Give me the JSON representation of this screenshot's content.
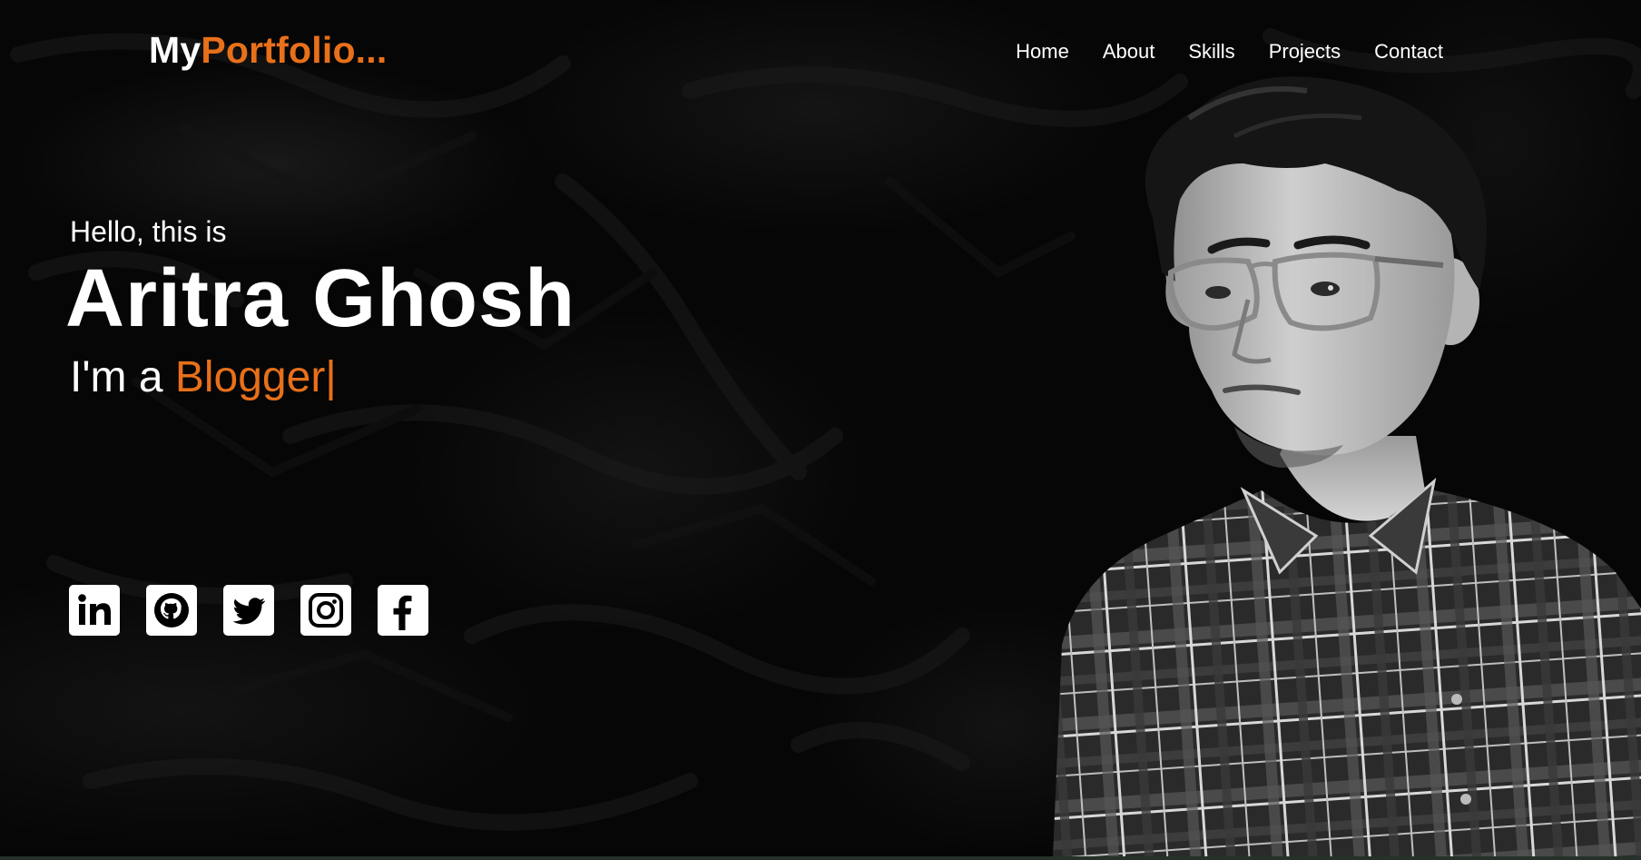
{
  "logo": {
    "prefix": "My",
    "accent": "Portfolio..."
  },
  "nav": {
    "items": [
      {
        "label": "Home"
      },
      {
        "label": "About"
      },
      {
        "label": "Skills"
      },
      {
        "label": "Projects"
      },
      {
        "label": "Contact"
      }
    ]
  },
  "hero": {
    "greeting": "Hello, this is",
    "name": "Aritra Ghosh",
    "role_prefix": "I'm a ",
    "role_typed": "Blogger|"
  },
  "socials": [
    {
      "icon": "linkedin-icon"
    },
    {
      "icon": "github-icon"
    },
    {
      "icon": "twitter-icon"
    },
    {
      "icon": "instagram-icon"
    },
    {
      "icon": "facebook-icon"
    }
  ],
  "colors": {
    "accent": "#e8701a",
    "background": "#060606",
    "text": "#ffffff"
  }
}
